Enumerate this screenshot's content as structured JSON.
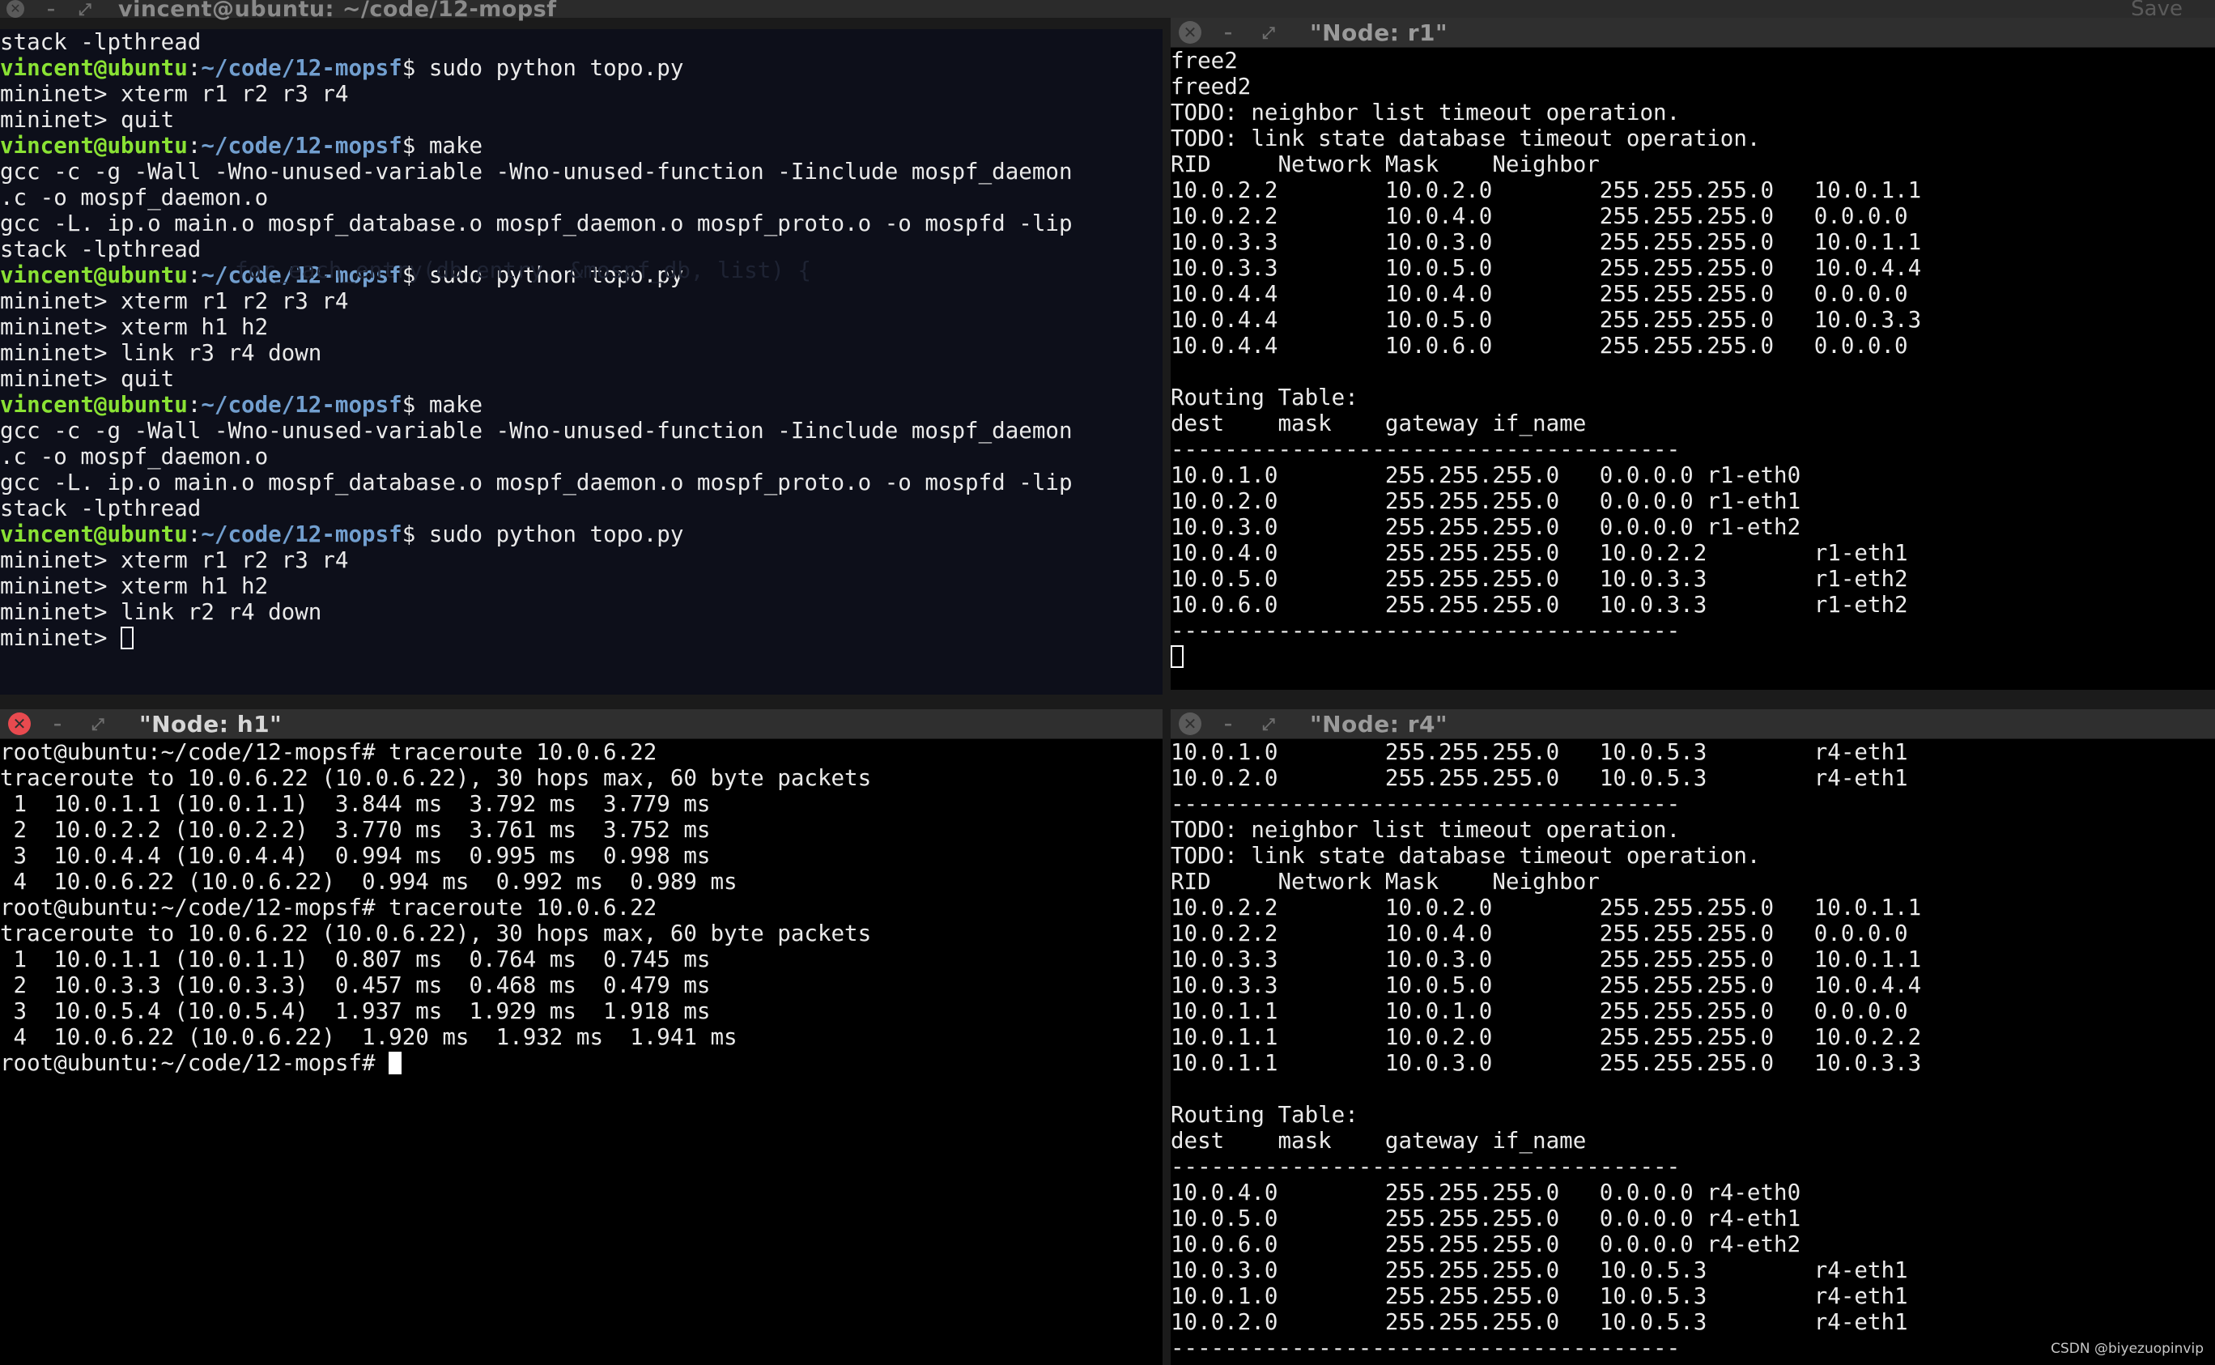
{
  "main_window": {
    "title": "vincent@ubuntu: ~/code/12-mopsf",
    "save_label": "Save",
    "prompt_user": "vincent@ubuntu",
    "prompt_path": "~/code/12-mopsf",
    "lines": [
      {
        "t": "text",
        "s": "stack -lpthread"
      },
      {
        "t": "prompt",
        "cmd": " sudo python topo.py"
      },
      {
        "t": "text",
        "s": "mininet> xterm r1 r2 r3 r4"
      },
      {
        "t": "text",
        "s": "mininet> quit"
      },
      {
        "t": "prompt",
        "cmd": " make"
      },
      {
        "t": "text",
        "s": "gcc -c -g -Wall -Wno-unused-variable -Wno-unused-function -Iinclude mospf_daemon"
      },
      {
        "t": "text",
        "s": ".c -o mospf_daemon.o"
      },
      {
        "t": "text",
        "s": "gcc -L. ip.o main.o mospf_database.o mospf_daemon.o mospf_proto.o -o mospfd -lip"
      },
      {
        "t": "text",
        "s": "stack -lpthread"
      },
      {
        "t": "prompt",
        "cmd": " sudo python topo.py"
      },
      {
        "t": "text",
        "s": "mininet> xterm r1 r2 r3 r4"
      },
      {
        "t": "text",
        "s": "mininet> xterm h1 h2"
      },
      {
        "t": "text",
        "s": "mininet> link r3 r4 down"
      },
      {
        "t": "text",
        "s": "mininet> quit"
      },
      {
        "t": "prompt",
        "cmd": " make"
      },
      {
        "t": "text",
        "s": "gcc -c -g -Wall -Wno-unused-variable -Wno-unused-function -Iinclude mospf_daemon"
      },
      {
        "t": "text",
        "s": ".c -o mospf_daemon.o"
      },
      {
        "t": "text",
        "s": "gcc -L. ip.o main.o mospf_database.o mospf_daemon.o mospf_proto.o -o mospfd -lip"
      },
      {
        "t": "text",
        "s": "stack -lpthread"
      },
      {
        "t": "prompt",
        "cmd": " sudo python topo.py"
      },
      {
        "t": "text",
        "s": "mininet> xterm r1 r2 r3 r4"
      },
      {
        "t": "text",
        "s": "mininet> xterm h1 h2"
      },
      {
        "t": "text",
        "s": "mininet> link r2 r4 down"
      },
      {
        "t": "input",
        "s": "mininet> "
      }
    ]
  },
  "window_r1": {
    "title": "\"Node: r1\"",
    "lines": [
      "free2",
      "freed2",
      "TODO: neighbor list timeout operation.",
      "TODO: link state database timeout operation.",
      "RID     Network Mask    Neighbor",
      "10.0.2.2        10.0.2.0        255.255.255.0   10.0.1.1",
      "10.0.2.2        10.0.4.0        255.255.255.0   0.0.0.0",
      "10.0.3.3        10.0.3.0        255.255.255.0   10.0.1.1",
      "10.0.3.3        10.0.5.0        255.255.255.0   10.0.4.4",
      "10.0.4.4        10.0.4.0        255.255.255.0   0.0.0.0",
      "10.0.4.4        10.0.5.0        255.255.255.0   10.0.3.3",
      "10.0.4.4        10.0.6.0        255.255.255.0   0.0.0.0",
      "",
      "Routing Table:",
      "dest    mask    gateway if_name",
      "--------------------------------------",
      "10.0.1.0        255.255.255.0   0.0.0.0 r1-eth0",
      "10.0.2.0        255.255.255.0   0.0.0.0 r1-eth1",
      "10.0.3.0        255.255.255.0   0.0.0.0 r1-eth2",
      "10.0.4.0        255.255.255.0   10.0.2.2        r1-eth1",
      "10.0.5.0        255.255.255.0   10.0.3.3        r1-eth2",
      "10.0.6.0        255.255.255.0   10.0.3.3        r1-eth2",
      "--------------------------------------"
    ]
  },
  "window_h1": {
    "title": "\"Node: h1\"",
    "lines": [
      "root@ubuntu:~/code/12-mopsf# traceroute 10.0.6.22",
      "traceroute to 10.0.6.22 (10.0.6.22), 30 hops max, 60 byte packets",
      " 1  10.0.1.1 (10.0.1.1)  3.844 ms  3.792 ms  3.779 ms",
      " 2  10.0.2.2 (10.0.2.2)  3.770 ms  3.761 ms  3.752 ms",
      " 3  10.0.4.4 (10.0.4.4)  0.994 ms  0.995 ms  0.998 ms",
      " 4  10.0.6.22 (10.0.6.22)  0.994 ms  0.992 ms  0.989 ms",
      "root@ubuntu:~/code/12-mopsf# traceroute 10.0.6.22",
      "traceroute to 10.0.6.22 (10.0.6.22), 30 hops max, 60 byte packets",
      " 1  10.0.1.1 (10.0.1.1)  0.807 ms  0.764 ms  0.745 ms",
      " 2  10.0.3.3 (10.0.3.3)  0.457 ms  0.468 ms  0.479 ms",
      " 3  10.0.5.4 (10.0.5.4)  1.937 ms  1.929 ms  1.918 ms",
      " 4  10.0.6.22 (10.0.6.22)  1.920 ms  1.932 ms  1.941 ms"
    ],
    "prompt": "root@ubuntu:~/code/12-mopsf# "
  },
  "window_r4": {
    "title": "\"Node: r4\"",
    "lines": [
      "10.0.1.0        255.255.255.0   10.0.5.3        r4-eth1",
      "10.0.2.0        255.255.255.0   10.0.5.3        r4-eth1",
      "--------------------------------------",
      "TODO: neighbor list timeout operation.",
      "TODO: link state database timeout operation.",
      "RID     Network Mask    Neighbor",
      "10.0.2.2        10.0.2.0        255.255.255.0   10.0.1.1",
      "10.0.2.2        10.0.4.0        255.255.255.0   0.0.0.0",
      "10.0.3.3        10.0.3.0        255.255.255.0   10.0.1.1",
      "10.0.3.3        10.0.5.0        255.255.255.0   10.0.4.4",
      "10.0.1.1        10.0.1.0        255.255.255.0   0.0.0.0",
      "10.0.1.1        10.0.2.0        255.255.255.0   10.0.2.2",
      "10.0.1.1        10.0.3.0        255.255.255.0   10.0.3.3",
      "",
      "Routing Table:",
      "dest    mask    gateway if_name",
      "--------------------------------------",
      "10.0.4.0        255.255.255.0   0.0.0.0 r4-eth0",
      "10.0.5.0        255.255.255.0   0.0.0.0 r4-eth1",
      "10.0.6.0        255.255.255.0   0.0.0.0 r4-eth2",
      "10.0.3.0        255.255.255.0   10.0.5.3        r4-eth1",
      "10.0.1.0        255.255.255.0   10.0.5.3        r4-eth1",
      "10.0.2.0        255.255.255.0   10.0.5.3        r4-eth1",
      "--------------------------------------"
    ]
  },
  "watermark": "CSDN @biyezuopinvip",
  "colors": {
    "prompt_user": "#8ae234",
    "prompt_path": "#729fcf",
    "close_active": "#e84a4f",
    "terminal_bg": "#000000",
    "main_terminal_bg": "#0d0f1a"
  },
  "icons": {
    "close": "close-icon",
    "minimize": "minimize-icon",
    "maximize": "maximize-icon"
  }
}
